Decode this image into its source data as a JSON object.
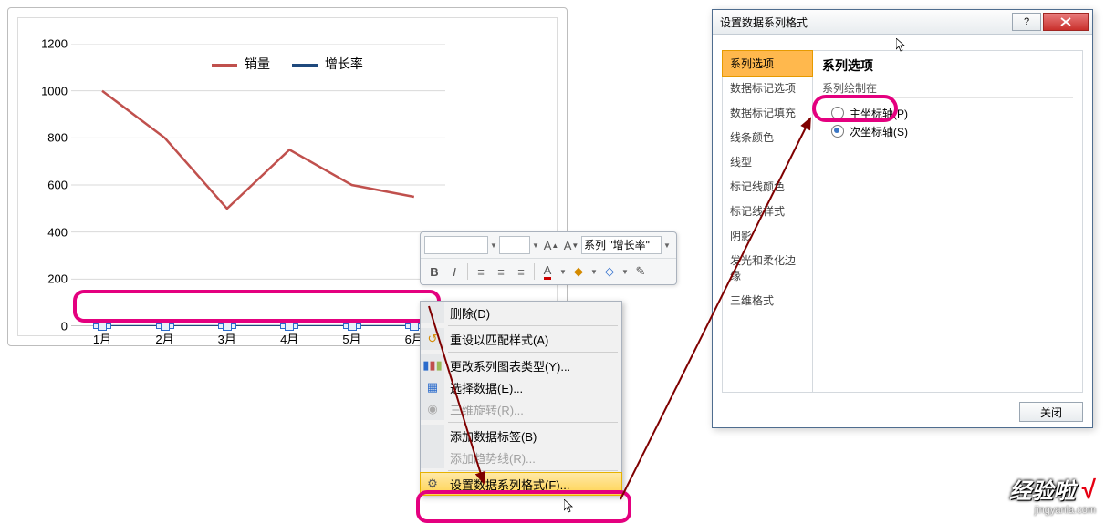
{
  "chart_data": {
    "type": "line",
    "categories": [
      "1月",
      "2月",
      "3月",
      "4月",
      "5月",
      "6月"
    ],
    "series": [
      {
        "name": "销量",
        "values": [
          1000,
          800,
          500,
          750,
          600,
          550
        ],
        "color": "#c0504d"
      },
      {
        "name": "增长率",
        "values": [
          0,
          0,
          0,
          0,
          0,
          0
        ],
        "color": "#1f497d"
      }
    ],
    "ylim": [
      0,
      1200
    ],
    "yticks": [
      0,
      200,
      400,
      600,
      800,
      1000,
      1200
    ],
    "xlabel": "",
    "ylabel": "",
    "title": ""
  },
  "legend": {
    "sales_label": "销量",
    "growth_label": "增长率"
  },
  "toolbar": {
    "series_name": "系列 \"增长率\""
  },
  "context_menu": {
    "delete": "删除(D)",
    "reset_style": "重设以匹配样式(A)",
    "change_type": "更改系列图表类型(Y)...",
    "select_data": "选择数据(E)...",
    "rotate_3d": "三维旋转(R)...",
    "add_labels": "添加数据标签(B)",
    "trendline": "添加趋势线(R)...",
    "format_series": "设置数据系列格式(F)..."
  },
  "dialog": {
    "title": "设置数据系列格式",
    "help_btn": "?",
    "sidebar": {
      "series_options": "系列选项",
      "marker_options": "数据标记选项",
      "marker_fill": "数据标记填充",
      "line_color": "线条颜色",
      "line_style": "线型",
      "marker_line_color": "标记线颜色",
      "marker_line_style": "标记线样式",
      "shadow": "阴影",
      "glow": "发光和柔化边缘",
      "format_3d": "三维格式"
    },
    "content": {
      "section_title": "系列选项",
      "group_label": "系列绘制在",
      "primary_axis": "主坐标轴(P)",
      "secondary_axis": "次坐标轴(S)"
    },
    "close_btn": "关闭"
  },
  "watermark": {
    "brand": "经验啦",
    "check": "√",
    "domain": "jingyanla.com"
  }
}
